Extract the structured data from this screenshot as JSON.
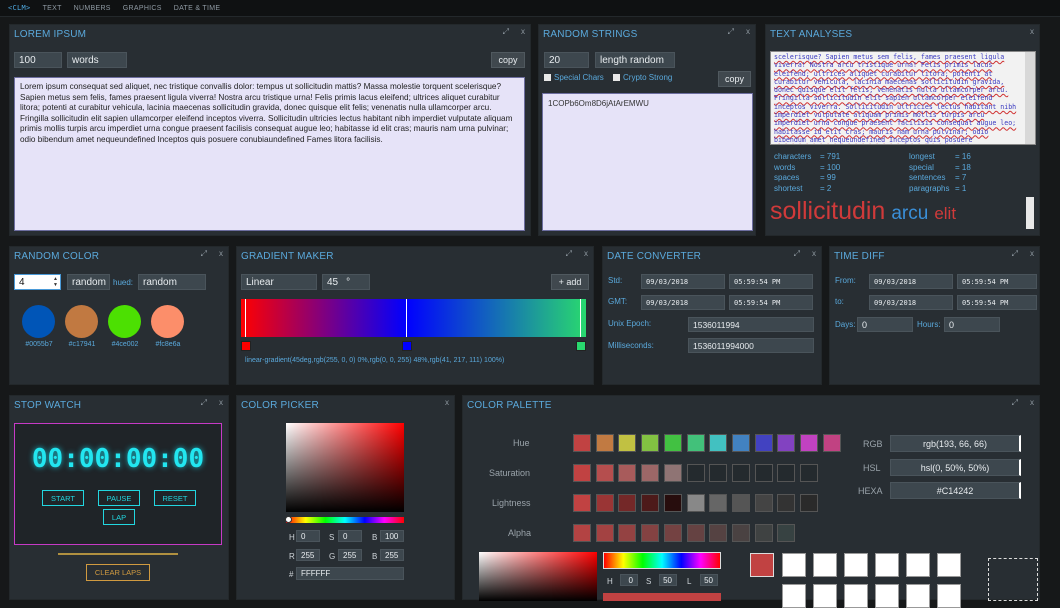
{
  "nav": {
    "logo": "<CLM>",
    "items": [
      "TEXT",
      "NUMBERS",
      "GRAPHICS",
      "DATE & TIME"
    ]
  },
  "controls": {
    "expand": "⤢",
    "close": "x"
  },
  "lorem": {
    "title": "LOREM IPSUM",
    "count": "100",
    "unit": "words",
    "copy": "copy",
    "text": "Lorem ipsum consequat sed aliquet, nec tristique convallis dolor: tempus ut sollicitudin mattis? Massa molestie torquent scelerisque? Sapien metus sem felis, fames praesent ligula viverra! Nostra arcu tristique urna! Felis primis lacus eleifend; ultrices aliquet curabitur litora; potenti at curabitur vehicula, lacinia maecenas sollicitudin gravida, donec quisque elit felis; venenatis nulla ullamcorper arcu. Fringilla sollicitudin elit sapien ullamcorper eleifend inceptos viverra. Sollicitudin ultricies lectus habitant nibh imperdiet vulputate aliquam primis mollis turpis arcu imperdiet urna congue praesent facilisis consequat augue leo; habitasse id elit cras; mauris nam urna pulvinar; odio bibendum amet nequeundefined Inceptos quis posuere conubiaundefined Fames litora facilisis."
  },
  "rstrings": {
    "title": "RANDOM STRINGS",
    "length": "20",
    "mode": "length random",
    "special": "Special Chars",
    "crypto": "Crypto Strong",
    "copy": "copy",
    "output": "1COPb6Om8D6jAtArEMWU"
  },
  "analysis": {
    "title": "TEXT ANALYSES",
    "text": "scelerisque? Sapien metus sem felis, fames praesent ligula viverra! Nostra arcu tristique urna! Felis primis lacus eleifend; ultrices aliquet curabitur litora; potenti at curabitur vehicula, lacinia maecenas sollicitudin gravida, donec quisque elit felis; venenatis nulla ullamcorper arcu. Fringilla sollicitudin elit sapien ullamcorper eleifend inceptos viverra. Sollicitudin ultricies lectus habitant nibh imperdiet vulputate aliquam primis mollis turpis arcu imperdiet urna congue praesent facilisis consequat augue leo; habitasse id elit cras; mauris nam urna pulvinar; odio bibendum amet nequeundefined Inceptos quis posuere conubiaundefined Fames litora facilisis.",
    "stats_left": [
      [
        "characters",
        "= 791"
      ],
      [
        "words",
        "= 100"
      ],
      [
        "spaces",
        "= 99"
      ],
      [
        "shortest",
        "= 2"
      ]
    ],
    "stats_right": [
      [
        "longest",
        "= 16"
      ],
      [
        "special",
        "= 18"
      ],
      [
        "sentences",
        "= 7"
      ],
      [
        "paragraphs",
        "= 1"
      ]
    ],
    "cloud": [
      {
        "word": "sollicitudin",
        "color": "#d03a3a"
      },
      {
        "word": "arcu",
        "color": "#3a8fd8"
      },
      {
        "word": "elit",
        "color": "#d03a3a"
      }
    ]
  },
  "rcolor": {
    "title": "RANDOM COLOR",
    "count": "4",
    "mode": "random",
    "hued_label": "hued:",
    "hued": "random",
    "colors": [
      {
        "hex": "#0055b7",
        "label": "#0055b7"
      },
      {
        "hex": "#c17941",
        "label": "#c17941"
      },
      {
        "hex": "#4ce002",
        "label": "#4ce002"
      },
      {
        "hex": "#fc8e6a",
        "label": "#fc8e6a"
      }
    ]
  },
  "gradient": {
    "title": "GRADIENT MAKER",
    "type": "Linear",
    "angle": "45",
    "deg": "°",
    "add": "+ add",
    "css": "linear-gradient(45deg,rgb(255, 0, 0) 0%,rgb(0, 0, 255) 48%,rgb(41, 217, 111) 100%)",
    "stops": [
      {
        "color": "#ff0000",
        "pos": 0
      },
      {
        "color": "#0000ff",
        "pos": 48
      },
      {
        "color": "#29d96f",
        "pos": 100
      }
    ]
  },
  "date": {
    "title": "DATE CONVERTER",
    "std_label": "Std:",
    "gmt_label": "GMT:",
    "unix_label": "Unix Epoch:",
    "ms_label": "Milliseconds:",
    "std_date": "09/03/2018",
    "std_time": "05:59:54 PM",
    "gmt_date": "09/03/2018",
    "gmt_time": "05:59:54 PM",
    "unix": "1536011994",
    "ms": "1536011994000"
  },
  "tdiff": {
    "title": "TIME DIFF",
    "from_label": "From:",
    "to_label": "to:",
    "days_label": "Days:",
    "hours_label": "Hours:",
    "from_date": "09/03/2018",
    "from_time": "05:59:54 PM",
    "to_date": "09/03/2018",
    "to_time": "05:59:54 PM",
    "days": "0",
    "hours": "0"
  },
  "stopwatch": {
    "title": "STOP WATCH",
    "time": "00:00:00:00",
    "start": "START",
    "pause": "PAUSE",
    "reset": "RESET",
    "lap": "LAP",
    "clear": "CLEAR LAPS"
  },
  "picker": {
    "title": "COLOR PICKER",
    "h": "0",
    "s": "0",
    "b": "100",
    "r": "255",
    "g": "255",
    "bb": "255",
    "hash": "#",
    "hex": "FFFFFF"
  },
  "palette": {
    "title": "COLOR PALETTE",
    "rows": [
      {
        "label": "Hue",
        "colors": [
          "#c14242",
          "#c17a42",
          "#c1c142",
          "#82c142",
          "#42c142",
          "#42c17a",
          "#42c1c1",
          "#4282c1",
          "#4242c1",
          "#8242c1",
          "#c142c1",
          "#c14282"
        ]
      },
      {
        "label": "Saturation",
        "colors": [
          "#c14242",
          "#b54e4e",
          "#a85b5b",
          "#9c6767",
          "#8f7474",
          "#242a2e",
          "#242a2e",
          "#242a2e",
          "#242a2e",
          "#242a2e",
          "#242a2e"
        ]
      },
      {
        "label": "Lightness",
        "colors": [
          "#c14242",
          "#9a3535",
          "#742828",
          "#4d1a1a",
          "#270d0d",
          "#888888",
          "#666666",
          "#555555",
          "#444444",
          "#333333",
          "#2a2a2a"
        ]
      },
      {
        "label": "Alpha",
        "colors": [
          "#b34343",
          "#a34242",
          "#944242",
          "#844242",
          "#744242",
          "#654242",
          "#554242",
          "#4a4242",
          "#3f4242",
          "#374242"
        ]
      }
    ],
    "rgb_label": "RGB",
    "hsl_label": "HSL",
    "hexa_label": "HEXA",
    "rgb": "rgb(193, 66, 66)",
    "hsl": "hsl(0, 50%, 50%)",
    "hexa": "#C14242",
    "h": "0",
    "s": "50",
    "l": "50"
  }
}
